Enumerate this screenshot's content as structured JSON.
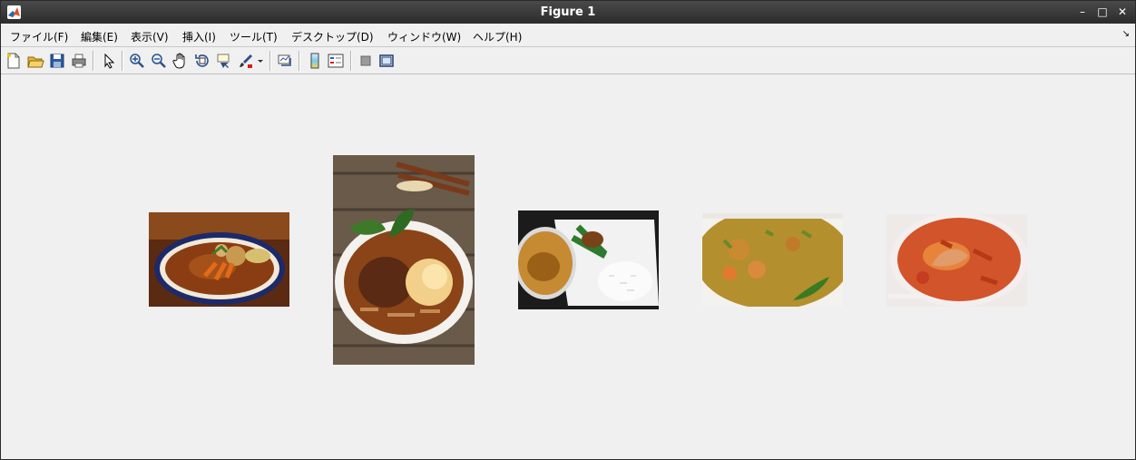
{
  "window": {
    "title": "Figure 1"
  },
  "window_controls": {
    "minimize": "–",
    "maximize": "□",
    "close": "✕"
  },
  "menu": {
    "items": [
      {
        "label": "ファイル(F)"
      },
      {
        "label": "編集(E)"
      },
      {
        "label": "表示(V)"
      },
      {
        "label": "挿入(I)"
      },
      {
        "label": "ツール(T)"
      },
      {
        "label": "デスクトップ(D)"
      },
      {
        "label": "ウィンドウ(W)"
      },
      {
        "label": "ヘルプ(H)"
      }
    ],
    "dock_arrow": "↘"
  },
  "toolbar": {
    "icons": [
      "new-figure-icon",
      "open-file-icon",
      "save-icon",
      "print-icon",
      "pointer-icon",
      "zoom-in-icon",
      "zoom-out-icon",
      "pan-hand-icon",
      "rotate-3d-icon",
      "data-cursor-icon",
      "brush-icon",
      "brush-dropdown-icon",
      "link-plot-icon",
      "colorbar-icon",
      "legend-icon",
      "hide-plot-tools-icon",
      "show-plot-tools-icon"
    ]
  },
  "images": [
    {
      "name": "curry-bowl-image-1"
    },
    {
      "name": "curry-bowl-image-2"
    },
    {
      "name": "curry-bento-image-3"
    },
    {
      "name": "curry-shrimp-image-4"
    },
    {
      "name": "curry-red-image-5"
    }
  ]
}
